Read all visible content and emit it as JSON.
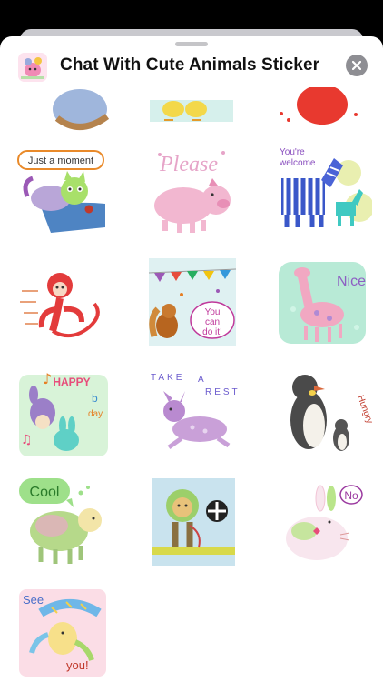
{
  "app": {
    "title": "Chat With Cute Animals Sticker",
    "icon": "app-sticker-icon",
    "close_icon": "close-icon"
  },
  "stickers": [
    {
      "name": "sticker-bird",
      "caption": ""
    },
    {
      "name": "sticker-chicks",
      "caption": ""
    },
    {
      "name": "sticker-red-animal",
      "caption": ""
    },
    {
      "name": "sticker-cat-just-a-moment",
      "caption": "Just a moment"
    },
    {
      "name": "sticker-pig-please",
      "caption": "Please"
    },
    {
      "name": "sticker-zebra-welcome",
      "caption": "You're welcome"
    },
    {
      "name": "sticker-monkey",
      "caption": ""
    },
    {
      "name": "sticker-squirrel-you-can-do-it",
      "caption": "You can do it!"
    },
    {
      "name": "sticker-giraffe-nice",
      "caption": "Nice"
    },
    {
      "name": "sticker-bunnies-happy-bday",
      "caption": "HAPPY b-day"
    },
    {
      "name": "sticker-deer-take-a-rest",
      "caption": "TAKE A REST"
    },
    {
      "name": "sticker-penguins-hungry",
      "caption": "Hungry"
    },
    {
      "name": "sticker-sheep-cool",
      "caption": "Cool"
    },
    {
      "name": "sticker-lion",
      "caption": ""
    },
    {
      "name": "sticker-rabbit-no",
      "caption": "No"
    },
    {
      "name": "sticker-bird-see-you",
      "caption": "See you!"
    }
  ],
  "labels": {
    "just_a_moment": "Just a moment",
    "please": "Please",
    "youre": "You're",
    "welcome": "welcome",
    "you": "You",
    "can": "can",
    "do_it": "do it!",
    "nice": "Nice",
    "happy": "HAPPY",
    "b": "b",
    "day": "day",
    "take": "TAKE",
    "a": "A",
    "rest": "REST",
    "hungry": "Hungry",
    "cool": "Cool",
    "no": "No",
    "see": "See",
    "you_excl": "you!"
  }
}
